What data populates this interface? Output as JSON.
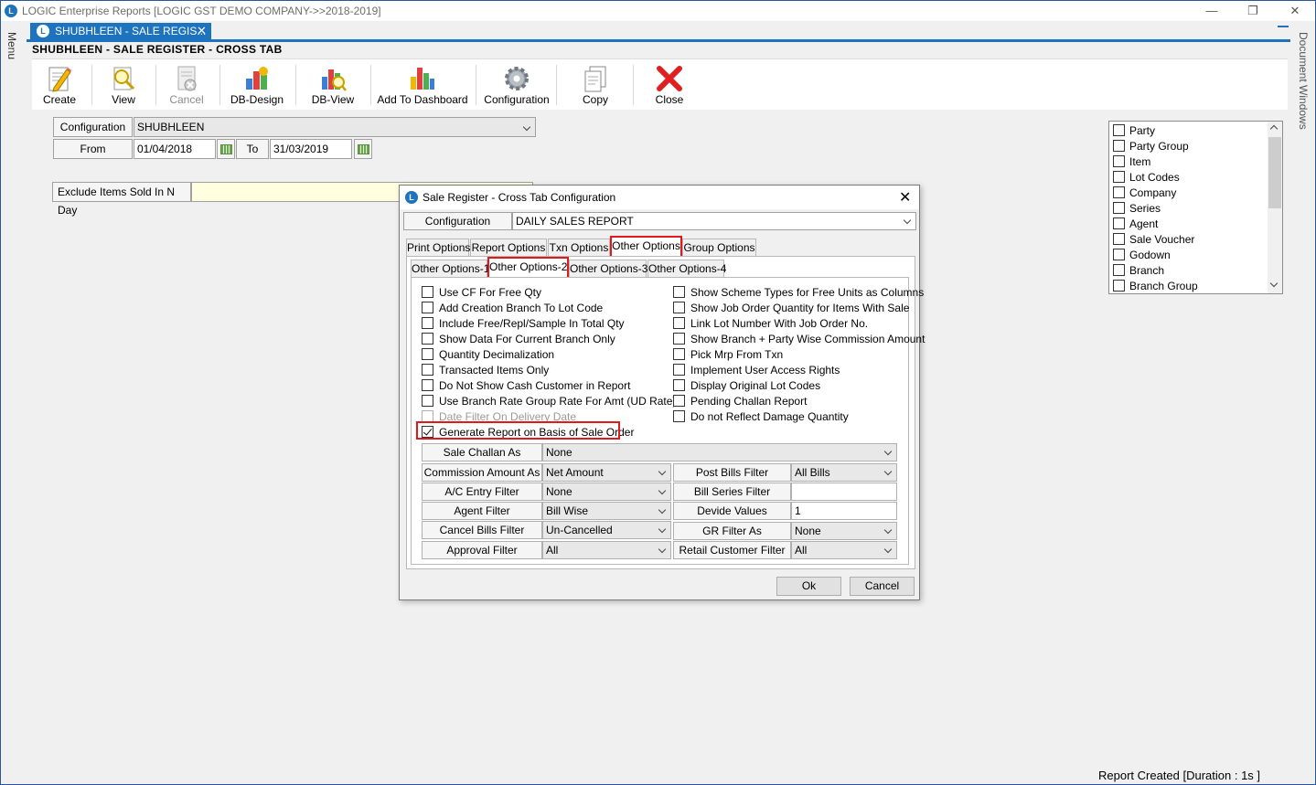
{
  "window": {
    "title": "LOGIC Enterprise Reports [LOGIC GST DEMO COMPANY->>2018-2019]",
    "minimize": "—",
    "restore": "❐",
    "close": "✕"
  },
  "side": {
    "menu_label": "Menu",
    "doc_windows_label": "Document Windows"
  },
  "doc_tab": {
    "label": "SHUBHLEEN - SALE REGIS...",
    "close": "✕"
  },
  "report_title": "SHUBHLEEN - SALE REGISTER - CROSS TAB",
  "toolbar": {
    "create": "Create",
    "view": "View",
    "cancel": "Cancel",
    "db_design": "DB-Design",
    "db_view": "DB-View",
    "add_dashboard": "Add To Dashboard",
    "configuration": "Configuration",
    "copy": "Copy",
    "close": "Close"
  },
  "form": {
    "config_label": "Configuration",
    "config_value": "SHUBHLEEN",
    "from_label": "From",
    "from_value": "01/04/2018",
    "to_label": "To",
    "to_value": "31/03/2019",
    "exclude_label": "Exclude Items Sold In N Day"
  },
  "right_list": {
    "items": [
      "Party",
      "Party Group",
      "Item",
      "Lot Codes",
      "Company",
      "Series",
      "Agent",
      "Sale Voucher",
      "Godown",
      "Branch",
      "Branch Group"
    ]
  },
  "status": "Report Created [Duration : 1s ]",
  "dialog": {
    "title": "Sale Register - Cross Tab Configuration",
    "close": "✕",
    "config_label": "Configuration",
    "config_value": "DAILY SALES REPORT",
    "tabs": [
      "Print Options",
      "Report Options",
      "Txn Options",
      "Other Options",
      "Group Options"
    ],
    "subtabs": [
      "Other Options-1",
      "Other Options-2",
      "Other Options-3",
      "Other Options-4"
    ],
    "left_options": [
      "Use CF For Free Qty",
      "Add Creation Branch To Lot Code",
      "Include Free/Repl/Sample In Total Qty",
      "Show Data For Current Branch Only",
      "Quantity Decimalization",
      "Transacted Items Only",
      "Do Not Show Cash Customer in Report",
      "Use Branch Rate Group Rate For Amt (UD Rate)",
      "Date Filter On Delivery Date",
      "Generate Report on Basis of Sale Order"
    ],
    "right_options": [
      "Show Scheme Types for Free Units as Columns",
      "Show Job Order Quantity for Items With Sale",
      "Link Lot Number With Job Order No.",
      "Show Branch + Party Wise Commission Amount",
      "Pick Mrp From Txn",
      "Implement User Access Rights",
      "Display Original Lot Codes",
      "Pending Challan Report",
      "Do not Reflect Damage Quantity"
    ],
    "fields": {
      "sale_challan_label": "Sale Challan As",
      "sale_challan_value": "None",
      "commission_label": "Commission Amount As",
      "commission_value": "Net Amount",
      "post_bills_label": "Post Bills Filter",
      "post_bills_value": "All Bills",
      "ac_entry_label": "A/C Entry Filter",
      "ac_entry_value": "None",
      "bill_series_label": "Bill Series Filter",
      "bill_series_value": "",
      "agent_label": "Agent Filter",
      "agent_value": "Bill Wise",
      "devide_label": "Devide Values",
      "devide_value": "1",
      "cancel_bills_label": "Cancel Bills Filter",
      "cancel_bills_value": "Un-Cancelled",
      "gr_label": "GR Filter As",
      "gr_value": "None",
      "approval_label": "Approval Filter",
      "approval_value": "All",
      "retail_label": "Retail Customer Filter",
      "retail_value": "All"
    },
    "ok": "Ok",
    "cancel": "Cancel"
  }
}
